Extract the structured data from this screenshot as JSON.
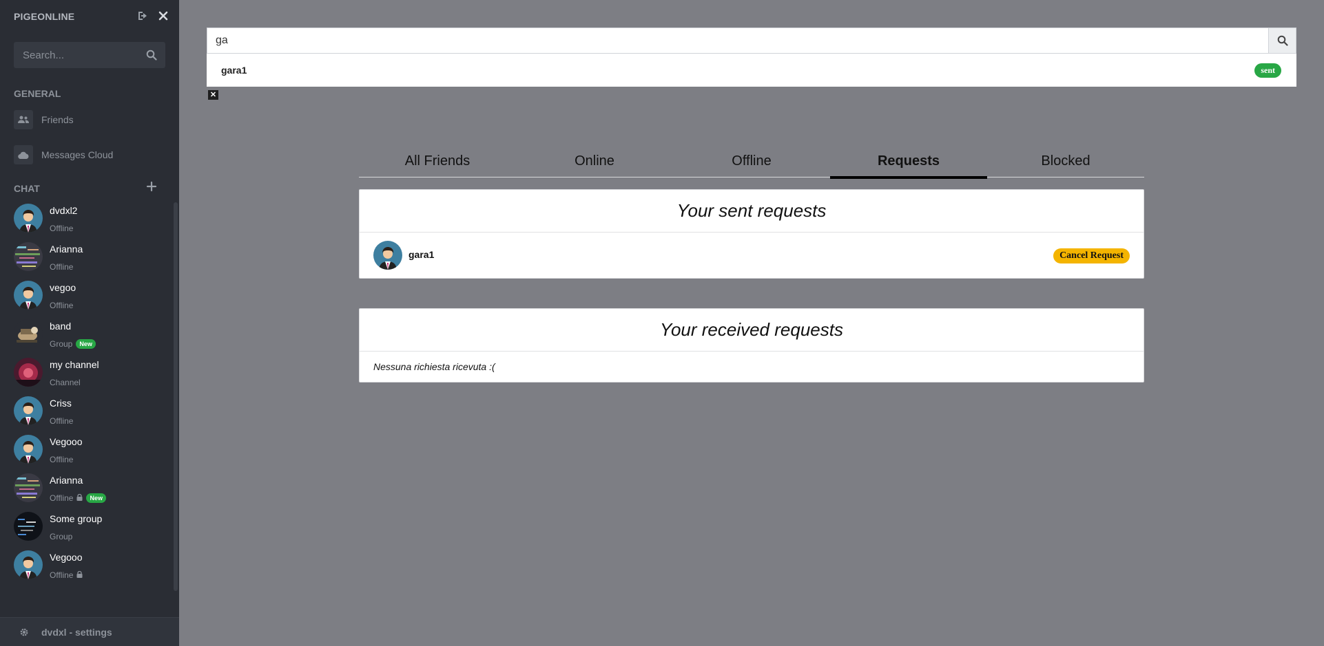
{
  "sidebar": {
    "brand": "PIGEONLINE",
    "search_placeholder": "Search...",
    "general_title": "GENERAL",
    "nav": [
      {
        "label": "Friends"
      },
      {
        "label": "Messages Cloud"
      }
    ],
    "chat_title": "CHAT",
    "chats": [
      {
        "name": "dvdxl2",
        "status": "Offline",
        "avatar": "man"
      },
      {
        "name": "Arianna",
        "status": "Offline",
        "avatar": "pixel"
      },
      {
        "name": "vegoo",
        "status": "Offline",
        "avatar": "man"
      },
      {
        "name": "band",
        "status": "Group",
        "badge": "New",
        "avatar": "band"
      },
      {
        "name": "my channel",
        "status": "Channel",
        "avatar": "red"
      },
      {
        "name": "Criss",
        "status": "Offline",
        "avatar": "man"
      },
      {
        "name": "Vegooo",
        "status": "Offline",
        "avatar": "man"
      },
      {
        "name": "Arianna",
        "status": "Offline",
        "lock": true,
        "badge": "New",
        "avatar": "pixel"
      },
      {
        "name": "Some group",
        "status": "Group",
        "avatar": "dark"
      },
      {
        "name": "Vegooo",
        "status": "Offline",
        "lock": true,
        "avatar": "man"
      }
    ],
    "settings_label": "dvdxl - settings"
  },
  "search": {
    "value": "ga",
    "result_name": "gara1",
    "result_badge": "sent",
    "close_label": "✕"
  },
  "tabs": [
    "All Friends",
    "Online",
    "Offline",
    "Requests",
    "Blocked"
  ],
  "active_tab": "Requests",
  "sent_requests": {
    "title": "Your sent requests",
    "items": [
      {
        "name": "gara1",
        "action": "Cancel Request"
      }
    ]
  },
  "received_requests": {
    "title": "Your received requests",
    "empty_text": "Nessuna richiesta ricevuta :("
  }
}
